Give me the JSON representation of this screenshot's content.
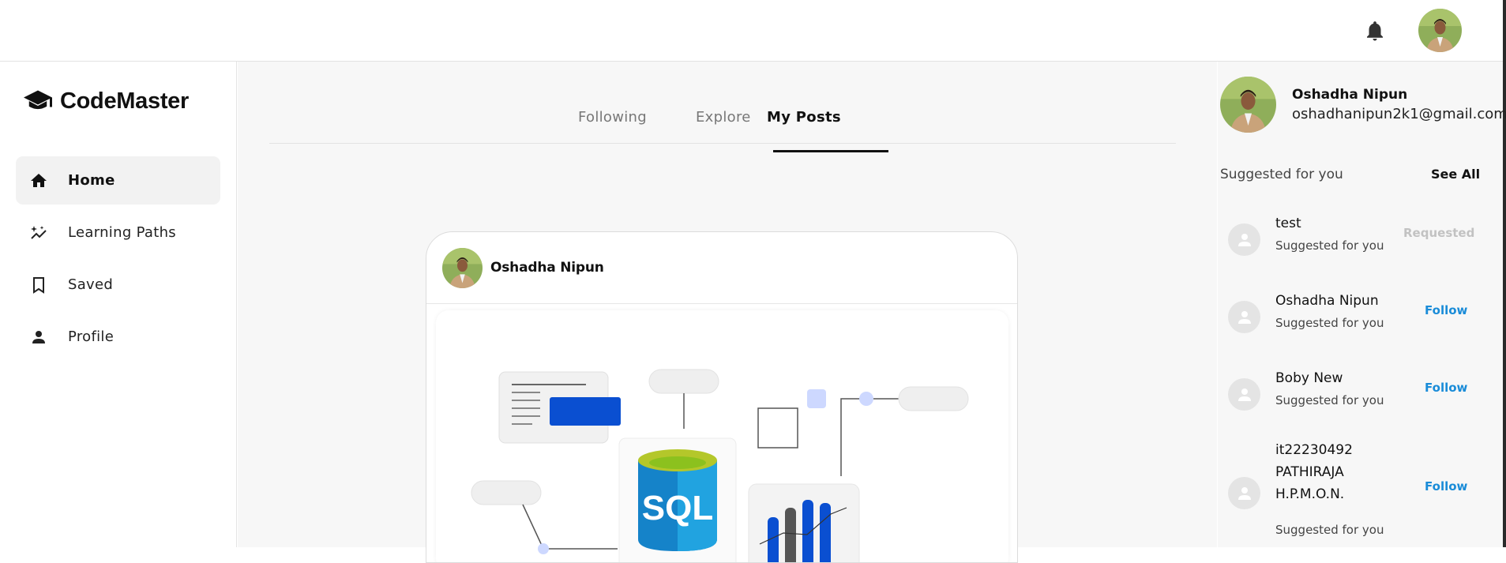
{
  "header": {
    "bell_icon": "bell-icon",
    "avatar_icon": "user-avatar"
  },
  "sidebar": {
    "brand": "CodeMaster",
    "brand_icon": "graduation-cap-icon",
    "items": [
      {
        "label": "Home",
        "icon": "home-icon",
        "active": true
      },
      {
        "label": "Learning Paths",
        "icon": "sparkle-chart-icon",
        "active": false
      },
      {
        "label": "Saved",
        "icon": "bookmark-icon",
        "active": false
      },
      {
        "label": "Profile",
        "icon": "person-icon",
        "active": false
      }
    ]
  },
  "main": {
    "tabs": [
      {
        "label": "Following"
      },
      {
        "label": "Explore"
      },
      {
        "label": "My Posts",
        "active": true
      }
    ],
    "post": {
      "author": "Oshadha Nipun",
      "image_label": "SQL"
    }
  },
  "right": {
    "profile": {
      "name": "Oshadha Nipun",
      "email": "oshadhanipun2k1@gmail.com"
    },
    "suggested_title": "Suggested for you",
    "see_all": "See All",
    "suggestions": [
      {
        "name": "test",
        "sub": "Suggested for you",
        "action": "Requested"
      },
      {
        "name": "Oshadha Nipun",
        "sub": "Suggested for you",
        "action": "Follow"
      },
      {
        "name": "Boby New",
        "sub": "Suggested for you",
        "action": "Follow"
      },
      {
        "name": "it22230492 PATHIRAJA H.P.M.O.N.",
        "sub": "Suggested for you",
        "action": "Follow"
      }
    ]
  },
  "colors": {
    "accent_blue": "#1a8cd8",
    "requested_gray": "#c2c2c2",
    "active_nav_bg": "#f2f2f2"
  }
}
